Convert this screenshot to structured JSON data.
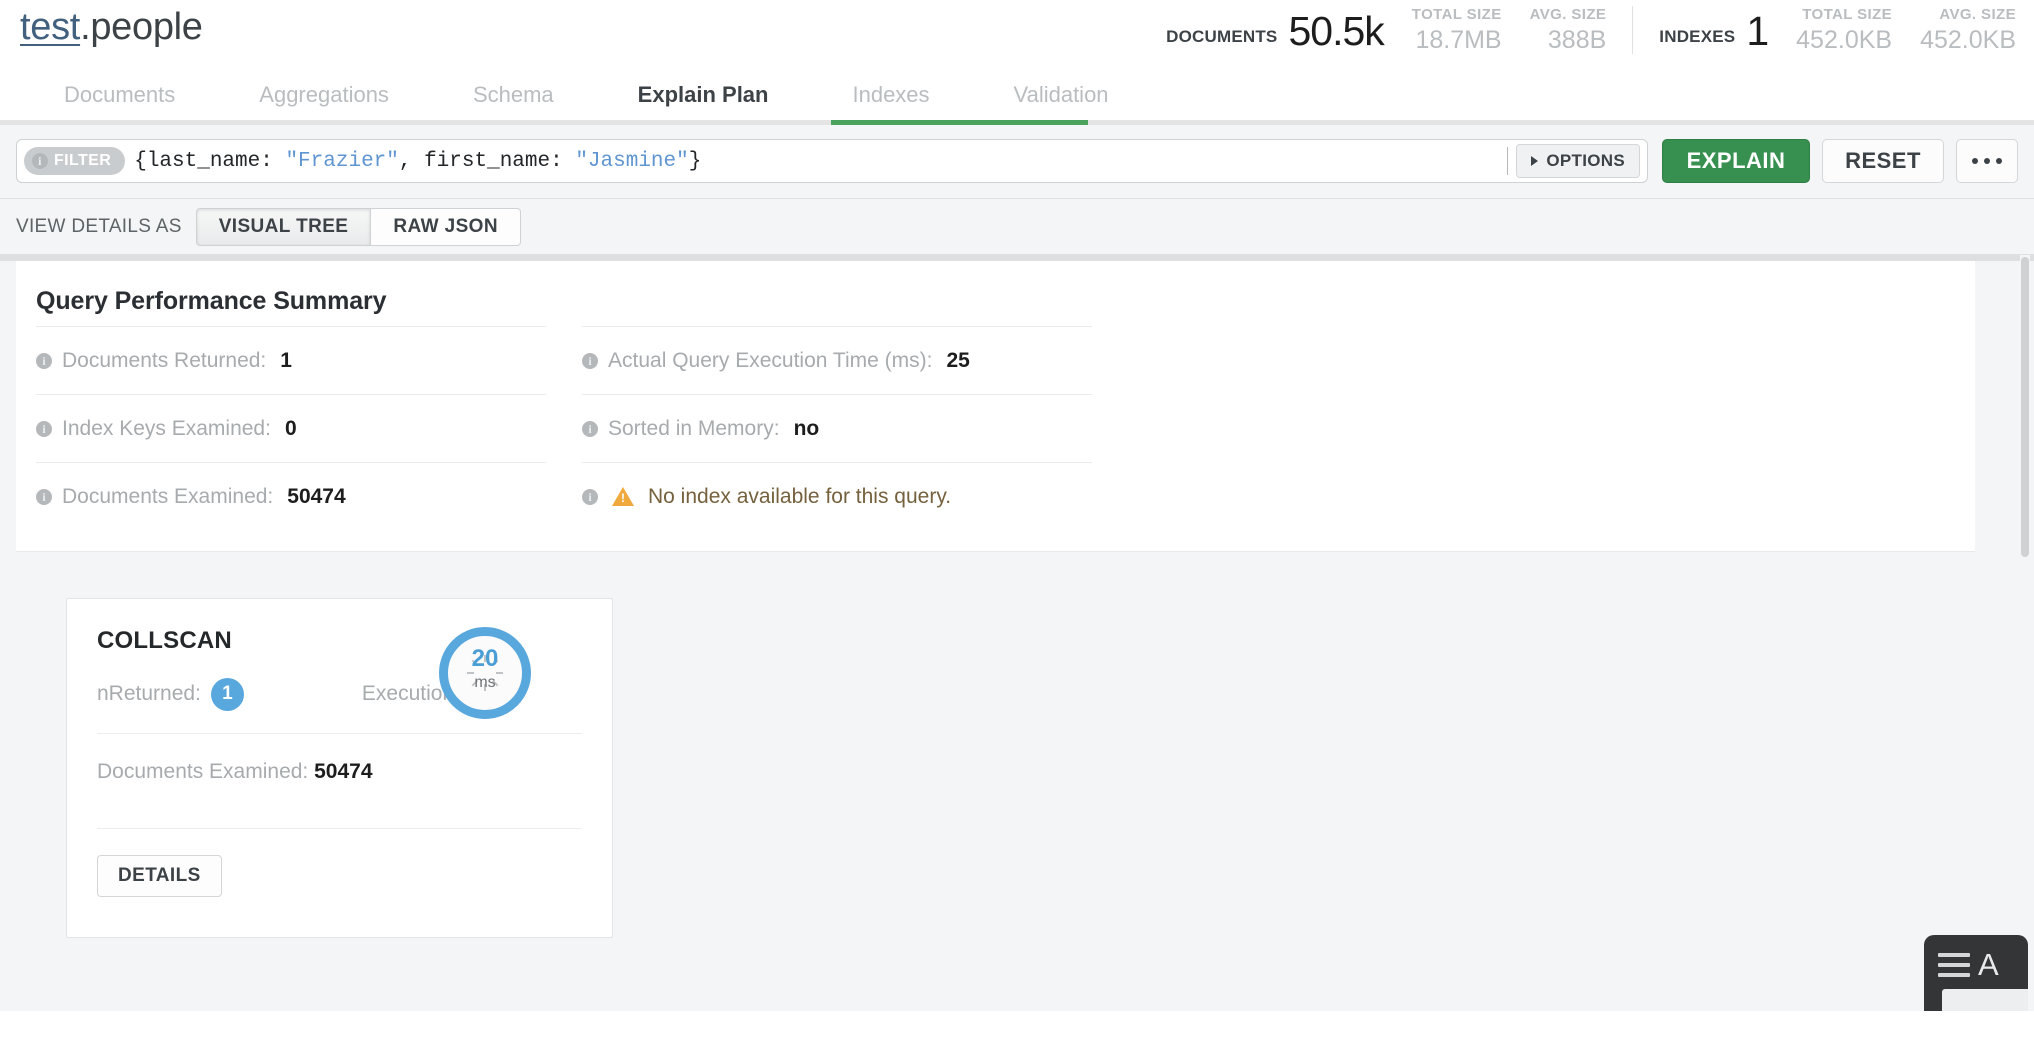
{
  "header": {
    "database": "test",
    "separator": ".",
    "collection": "people",
    "stats": [
      {
        "label": "DOCUMENTS",
        "value": "50.5k",
        "sub": [
          {
            "label": "TOTAL SIZE",
            "value": "18.7MB"
          },
          {
            "label": "AVG. SIZE",
            "value": "388B"
          }
        ]
      },
      {
        "label": "INDEXES",
        "value": "1",
        "sub": [
          {
            "label": "TOTAL SIZE",
            "value": "452.0KB"
          },
          {
            "label": "AVG. SIZE",
            "value": "452.0KB"
          }
        ]
      }
    ]
  },
  "tabs": [
    {
      "label": "Documents",
      "active": false
    },
    {
      "label": "Aggregations",
      "active": false
    },
    {
      "label": "Schema",
      "active": false
    },
    {
      "label": "Explain Plan",
      "active": true
    },
    {
      "label": "Indexes",
      "active": false
    },
    {
      "label": "Validation",
      "active": false
    }
  ],
  "query_bar": {
    "filter_badge": "FILTER",
    "filter_value": "{last_name: \"Frazier\", first_name: \"Jasmine\"}",
    "filter_tokens": [
      {
        "t": "{last_name: ",
        "k": "plain"
      },
      {
        "t": "\"Frazier\"",
        "k": "string"
      },
      {
        "t": ", first_name: ",
        "k": "plain"
      },
      {
        "t": "\"Jasmine\"",
        "k": "string"
      },
      {
        "t": "}",
        "k": "plain"
      }
    ],
    "options_label": "OPTIONS",
    "explain_label": "EXPLAIN",
    "reset_label": "RESET",
    "more_label": "•••"
  },
  "view_details": {
    "label": "VIEW DETAILS AS",
    "options": [
      {
        "label": "VISUAL TREE",
        "active": true
      },
      {
        "label": "RAW JSON",
        "active": false
      }
    ]
  },
  "summary": {
    "title": "Query Performance Summary",
    "left": [
      {
        "label": "Documents Returned:",
        "value": "1"
      },
      {
        "label": "Index Keys Examined:",
        "value": "0"
      },
      {
        "label": "Documents Examined:",
        "value": "50474"
      }
    ],
    "right": [
      {
        "label": "Actual Query Execution Time (ms):",
        "value": "25"
      },
      {
        "label": "Sorted in Memory:",
        "value": "no"
      }
    ],
    "warning": "No index available for this query."
  },
  "stage": {
    "name": "COLLSCAN",
    "nreturned_label": "nReturned:",
    "nreturned_value": "1",
    "exec_time_label": "Execution Time:",
    "exec_time_value": "20",
    "exec_time_unit": "ms",
    "docs_examined_label": "Documents Examined:",
    "docs_examined_value": "50474",
    "details_label": "DETAILS"
  },
  "float_widget": {
    "letter": "A"
  },
  "colors": {
    "accent_green": "#37904f",
    "tab_underline": "#4ba25d",
    "badge_blue": "#58a7dd",
    "warning_amber": "#f0a93c",
    "link_blue": "#41617f"
  }
}
